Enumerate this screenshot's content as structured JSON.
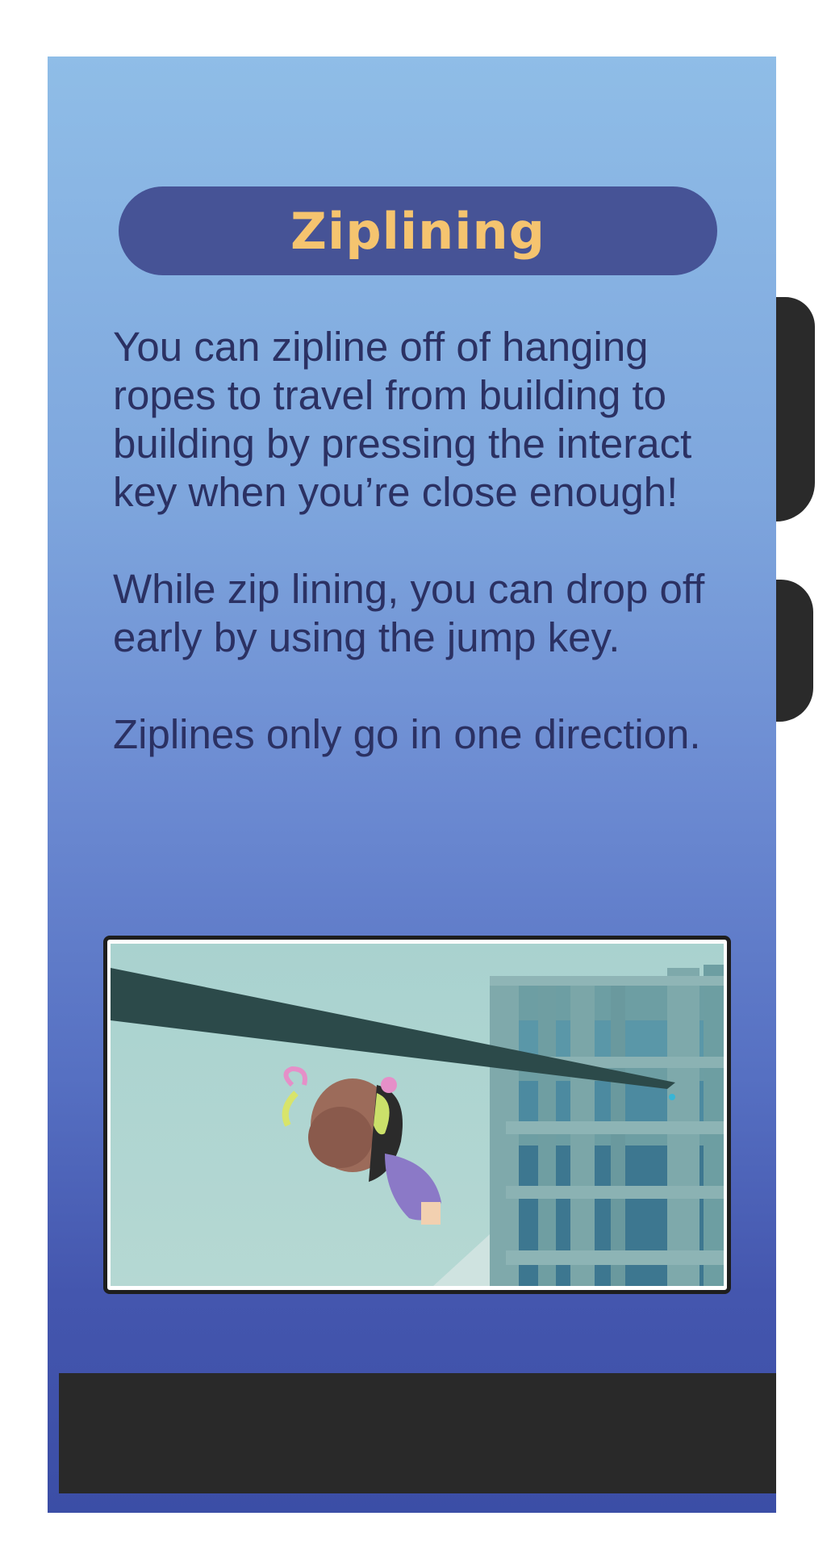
{
  "card": {
    "title": "Ziplining",
    "paragraphs": [
      "You can zipline off of hanging ropes to travel from building to building by pressing the interact key when you’re close enough!",
      "While zip lining, you can drop off early by using the jump key.",
      "Ziplines only go in one direction."
    ]
  },
  "colors": {
    "title_pill": "#465396",
    "title_text": "#f5c46f",
    "body_text": "#2b3163",
    "gradient_top": "#8fbde7",
    "gradient_bottom": "#3b4ea6"
  },
  "screenshot": {
    "subject": "character hanging from zipline rope beside building scaffold"
  }
}
